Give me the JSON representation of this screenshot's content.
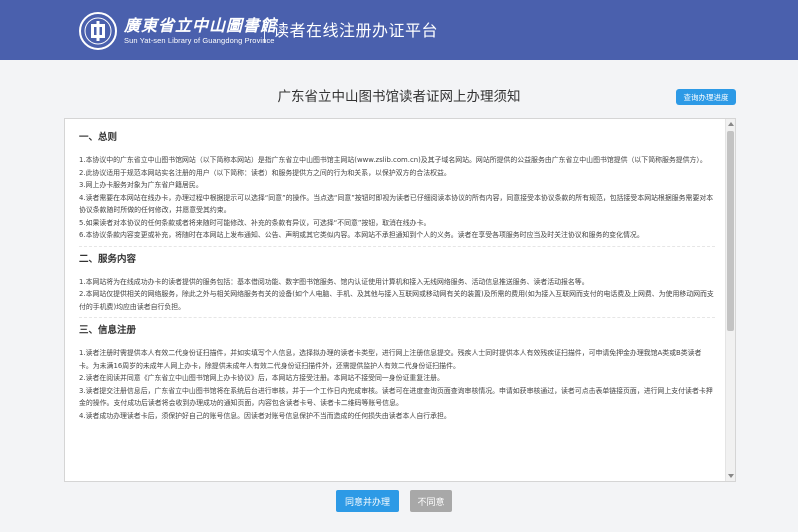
{
  "header": {
    "logo_cn": "廣東省立中山圖書館",
    "logo_en": "Sun Yat-sen Library of Guangdong Province",
    "platform_title": "读者在线注册办证平台",
    "brand_color": "#4a60ad"
  },
  "main": {
    "title": "广东省立中山图书馆读者证网上办理须知",
    "progress_button": "查询办理进度",
    "sections": [
      {
        "title": "一、总则",
        "paragraphs": [
          "1.本协议中的广东省立中山图书馆网站（以下简称本网站）是指广东省立中山图书馆主网站(www.zslib.com.cn)及其子域名网站。网站所提供的公益服务由广东省立中山图书馆提供（以下简称服务提供方）。",
          "2.此协议适用于规范本网站实名注册的用户（以下简称：读者）和服务提供方之间的行为和关系，以保护双方的合法权益。",
          "3.网上办卡服务对象为广东省户籍居民。",
          "4.读者需要在本网站在线办卡，办理过程中根据提示可以选择“同意”的操作。当点选“同意”按钮时即视为读者已仔细阅读本协议的所有内容，同意接受本协议条款的所有规范，包括接受本网站根据服务需要对本协议条款随时所做的任何修改，并愿意受其约束。",
          "5.如果读者对本协议的任何条款或者将来随时可能修改、补充的条款有异议，可选择“不同意”按钮，取消在线办卡。",
          "6.本协议条款内容变更或补充，将随时在本网站上发布通知、公告、声明或其它类似内容。本网站不承担通知到个人的义务。读者在享受各项服务时应当及时关注协议和服务的变化情况。"
        ]
      },
      {
        "title": "二、服务内容",
        "paragraphs": [
          "1.本网站将为在线成功办卡的读者提供的服务包括：基本借阅功能、数字图书馆服务、馆内认证使用计算机和接入无线网络服务、活动信息推送服务、读者活动报名等。",
          "2.本网站仅提供相关的网络服务，除此之外与相关网络服务有关的设备(如个人电脑、手机、及其他与接入互联网或移动网有关的装置)及所需的费用(如为接入互联网而支付的电话费及上网费、为使用移动网而支付的手机费)均应由读者自行负担。"
        ]
      },
      {
        "title": "三、信息注册",
        "paragraphs": [
          "1.读者注册时需提供本人有效二代身份证扫描件，并如实填写个人信息，选择拟办理的读者卡类型，进行网上注册信息提交。残疾人士同时提供本人有效残疾证扫描件，可申请免押金办理我馆A类或B类读者卡。为未满16周岁的未成年人网上办卡，除提供未成年人有效二代身份证扫描件外，还需提供监护人有效二代身份证扫描件。",
          "2.读者在阅读并同意《广东省立中山图书馆网上办卡协议》后，本网站方接受注册。本网站不接受同一身份证重复注册。",
          "3.读者提交注册信息后，广东省立中山图书馆将在系统后台进行审核，并于一个工作日内完成审核。读者可在进度查询页面查询审核情况。申请如获审核通过，读者可点击表单链接页面，进行网上支付读者卡押金的操作。支付成功后读者将会收到办理成功的通知页面，内容包含读者卡号、读者卡二维码等账号信息。",
          "4.读者成功办理读者卡后，须保护好自己的账号信息。因读者对账号信息保护不当而造成的任何损失由读者本人自行承担。"
        ]
      }
    ]
  },
  "actions": {
    "agree": "同意并办理",
    "disagree": "不同意"
  }
}
